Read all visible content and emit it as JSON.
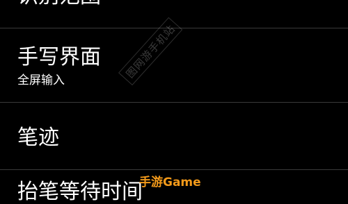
{
  "settings_list": {
    "items": [
      {
        "title": "识别范围"
      },
      {
        "title": "手写界面",
        "subtitle": "全屏输入"
      },
      {
        "title": "笔迹"
      },
      {
        "title": "抬笔等待时间"
      }
    ]
  },
  "watermark": {
    "text": "图网游手机站"
  },
  "brand": {
    "text": "手游Game",
    "color": "#f39a1a"
  }
}
